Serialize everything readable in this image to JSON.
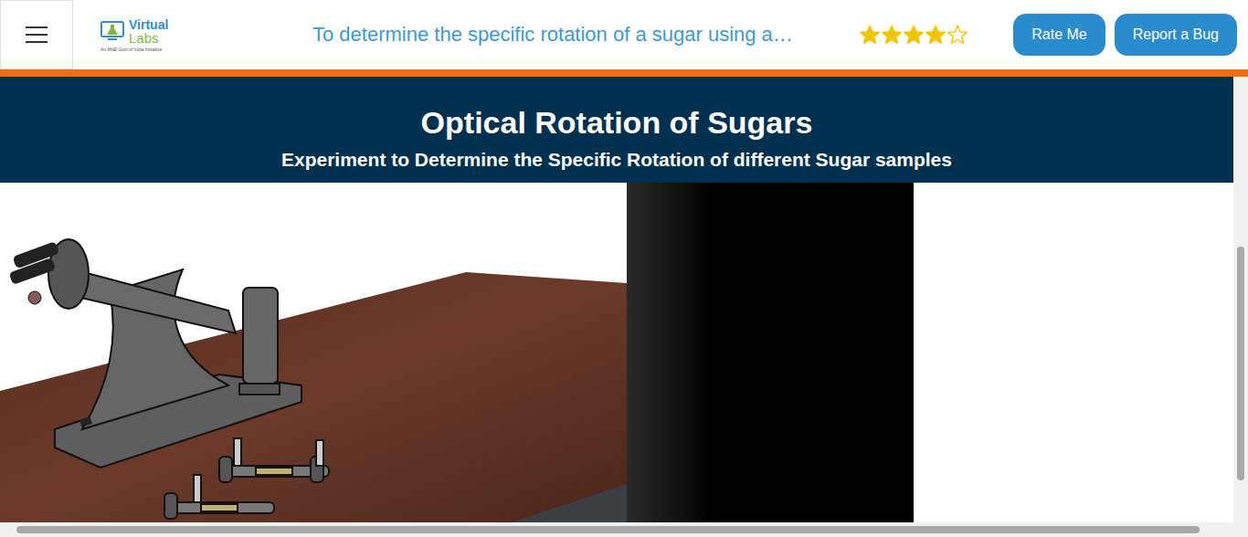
{
  "header": {
    "logo": {
      "line1": "Virtual",
      "line2": "Labs",
      "tagline": "An MoE Govt of India Initiative"
    },
    "title": "To determine the specific rotation of a sugar using a…",
    "rating": {
      "stars": 4,
      "max": 5
    },
    "buttons": [
      "Rate Me",
      "Report a Bug"
    ]
  },
  "banner": {
    "title": "Optical Rotation of Sugars",
    "subtitle": "Experiment to Determine the Specific Rotation of different Sugar samples"
  }
}
